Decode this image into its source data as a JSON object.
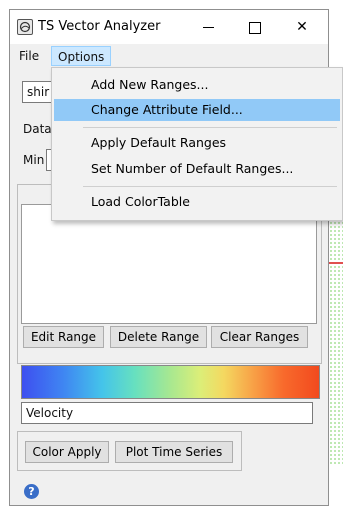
{
  "window": {
    "title": "TS Vector Analyzer",
    "controls": {
      "minimize": "—",
      "maximize": "☐",
      "close": "✕"
    }
  },
  "menubar": {
    "file": "File",
    "options": "Options"
  },
  "dropdown": {
    "items": [
      {
        "label": "Add New Ranges..."
      },
      {
        "label": "Change Attribute Field...",
        "highlighted": true
      },
      {
        "label": "Apply Default Ranges"
      },
      {
        "label": "Set Number of Default Ranges..."
      },
      {
        "label": "Load ColorTable"
      }
    ]
  },
  "form": {
    "combo_value_partial": "shir",
    "data_label_partial": "Data",
    "min_label": "Min"
  },
  "range_buttons": {
    "edit": "Edit Range",
    "delete": "Delete Range",
    "clear": "Clear Ranges"
  },
  "colorbar": {
    "attribute": "Velocity",
    "colors": [
      "#3e4ff0",
      "#3f86f2",
      "#44c4ea",
      "#67e0bf",
      "#a8e890",
      "#dcee78",
      "#f4d860",
      "#f8a046",
      "#f86a2c",
      "#f24a1e"
    ]
  },
  "bottom_buttons": {
    "color_apply": "Color Apply",
    "plot_time_series": "Plot Time Series"
  },
  "help": {
    "icon": "help-icon",
    "glyph": "?"
  },
  "accent": {
    "menu_highlight": "#91c9f7",
    "menubar_selected": "#cce8ff"
  }
}
